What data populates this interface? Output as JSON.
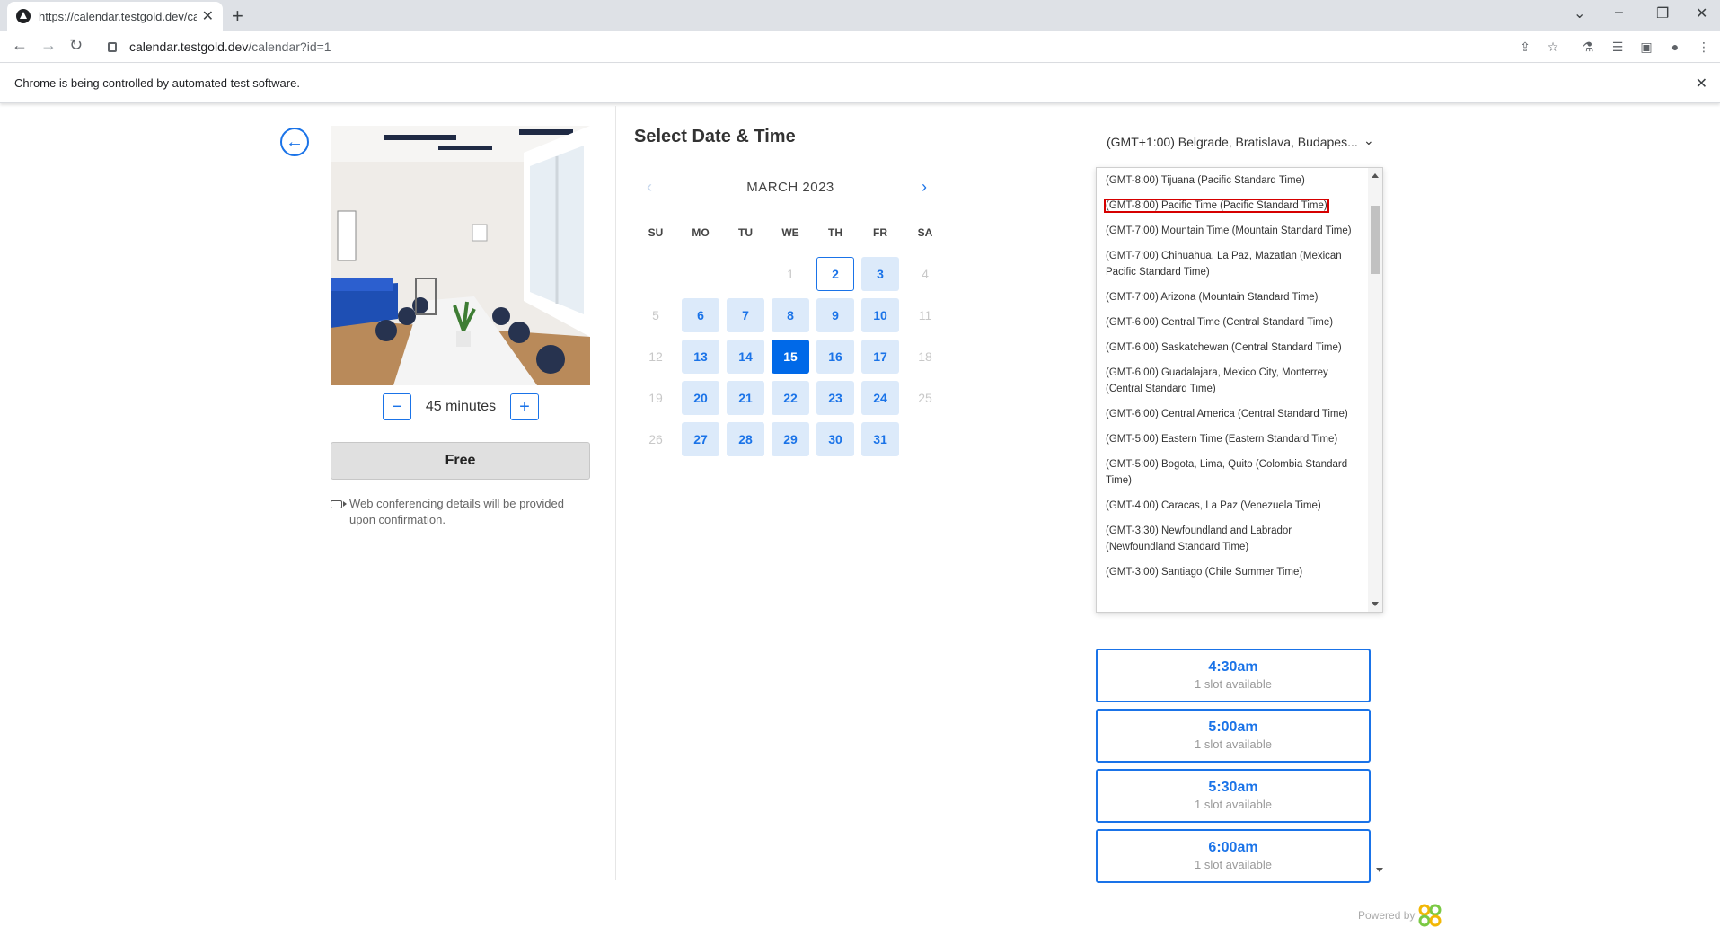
{
  "browser": {
    "tab_title": "https://calendar.testgold.dev/calendar?id=1",
    "url_host": "calendar.testgold.dev",
    "url_path": "/calendar?id=1",
    "infobar_text": "Chrome is being controlled by automated test software."
  },
  "event": {
    "duration_label": "45 minutes",
    "price_button": "Free",
    "conferencing_note": "Web conferencing details will be provided upon confirmation."
  },
  "calendar": {
    "heading": "Select Date & Time",
    "month_label": "MARCH 2023",
    "weekdays": [
      "SU",
      "MO",
      "TU",
      "WE",
      "TH",
      "FR",
      "SA"
    ],
    "weeks": [
      [
        {
          "d": "",
          "s": "blank"
        },
        {
          "d": "",
          "s": "blank"
        },
        {
          "d": "",
          "s": "blank"
        },
        {
          "d": "1",
          "s": "na"
        },
        {
          "d": "2",
          "s": "today"
        },
        {
          "d": "3",
          "s": "av"
        },
        {
          "d": "4",
          "s": "na"
        }
      ],
      [
        {
          "d": "5",
          "s": "na"
        },
        {
          "d": "6",
          "s": "av"
        },
        {
          "d": "7",
          "s": "av"
        },
        {
          "d": "8",
          "s": "av"
        },
        {
          "d": "9",
          "s": "av"
        },
        {
          "d": "10",
          "s": "av"
        },
        {
          "d": "11",
          "s": "na"
        }
      ],
      [
        {
          "d": "12",
          "s": "na"
        },
        {
          "d": "13",
          "s": "av"
        },
        {
          "d": "14",
          "s": "av"
        },
        {
          "d": "15",
          "s": "sel"
        },
        {
          "d": "16",
          "s": "av"
        },
        {
          "d": "17",
          "s": "av"
        },
        {
          "d": "18",
          "s": "na"
        }
      ],
      [
        {
          "d": "19",
          "s": "na"
        },
        {
          "d": "20",
          "s": "av"
        },
        {
          "d": "21",
          "s": "av"
        },
        {
          "d": "22",
          "s": "av"
        },
        {
          "d": "23",
          "s": "av"
        },
        {
          "d": "24",
          "s": "av"
        },
        {
          "d": "25",
          "s": "na"
        }
      ],
      [
        {
          "d": "26",
          "s": "na"
        },
        {
          "d": "27",
          "s": "av"
        },
        {
          "d": "28",
          "s": "av"
        },
        {
          "d": "29",
          "s": "av"
        },
        {
          "d": "30",
          "s": "av"
        },
        {
          "d": "31",
          "s": "av"
        },
        {
          "d": "",
          "s": "blank"
        }
      ]
    ]
  },
  "timezone": {
    "selected": "(GMT+1:00) Belgrade, Bratislava, Budapes...",
    "highlighted_index": 1,
    "options": [
      "(GMT-8:00) Tijuana (Pacific Standard Time)",
      "(GMT-8:00) Pacific Time (Pacific Standard Time)",
      "(GMT-7:00) Mountain Time (Mountain Standard Time)",
      "(GMT-7:00) Chihuahua, La Paz, Mazatlan (Mexican Pacific Standard Time)",
      "(GMT-7:00) Arizona (Mountain Standard Time)",
      "(GMT-6:00) Central Time (Central Standard Time)",
      "(GMT-6:00) Saskatchewan (Central Standard Time)",
      "(GMT-6:00) Guadalajara, Mexico City, Monterrey (Central Standard Time)",
      "(GMT-6:00) Central America (Central Standard Time)",
      "(GMT-5:00) Eastern Time (Eastern Standard Time)",
      "(GMT-5:00) Bogota, Lima, Quito (Colombia Standard Time)",
      "(GMT-4:00) Caracas, La Paz (Venezuela Time)",
      "(GMT-3:30) Newfoundland and Labrador (Newfoundland Standard Time)",
      "(GMT-3:00) Santiago (Chile Summer Time)"
    ]
  },
  "slots": [
    {
      "time": "",
      "availability": "1 slot available"
    },
    {
      "time": "4:30am",
      "availability": "1 slot available"
    },
    {
      "time": "5:00am",
      "availability": "1 slot available"
    },
    {
      "time": "5:30am",
      "availability": "1 slot available"
    },
    {
      "time": "6:00am",
      "availability": "1 slot available"
    }
  ],
  "footer": {
    "powered_by": "Powered by"
  },
  "colors": {
    "accent": "#1a73e8",
    "available_day_bg": "#dceafa",
    "selected_day_bg": "#0069e8",
    "highlight_outline": "#d60000"
  }
}
